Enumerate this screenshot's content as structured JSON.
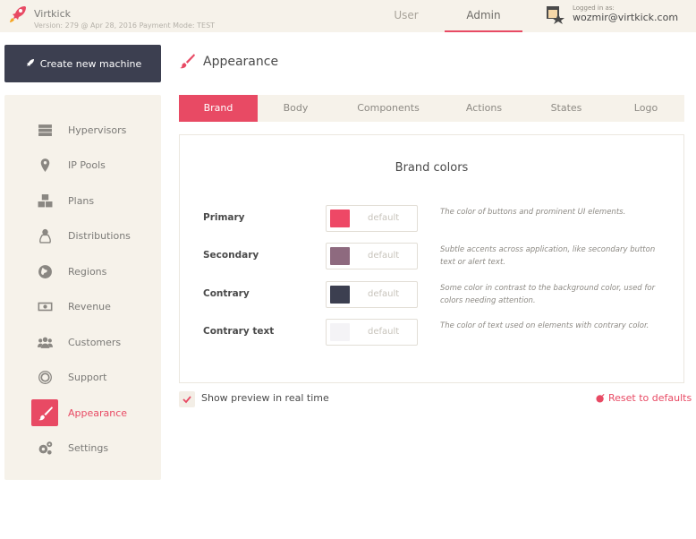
{
  "app": {
    "name": "Virtkick",
    "version_line": "Version: 279 @ Apr 28, 2016 Payment Mode: TEST"
  },
  "top_nav": {
    "tabs": [
      {
        "label": "User",
        "active": false
      },
      {
        "label": "Admin",
        "active": true
      }
    ],
    "logged_in_label": "Logged in as:",
    "logged_in_email": "wozmir@virtkick.com"
  },
  "create_button": {
    "label": "Create new machine",
    "icon": "rocket-icon"
  },
  "sidebar": {
    "items": [
      {
        "label": "Hypervisors",
        "icon": "server-icon",
        "active": false
      },
      {
        "label": "IP Pools",
        "icon": "map-pin-icon",
        "active": false
      },
      {
        "label": "Plans",
        "icon": "cubes-icon",
        "active": false
      },
      {
        "label": "Distributions",
        "icon": "linux-icon",
        "active": false
      },
      {
        "label": "Regions",
        "icon": "globe-icon",
        "active": false
      },
      {
        "label": "Revenue",
        "icon": "money-icon",
        "active": false
      },
      {
        "label": "Customers",
        "icon": "users-icon",
        "active": false
      },
      {
        "label": "Support",
        "icon": "life-ring-icon",
        "active": false
      },
      {
        "label": "Appearance",
        "icon": "paint-brush-icon",
        "active": true
      },
      {
        "label": "Settings",
        "icon": "gears-icon",
        "active": false
      }
    ]
  },
  "page": {
    "title": "Appearance",
    "icon": "paint-brush-icon"
  },
  "tabs": [
    {
      "label": "Brand",
      "active": true
    },
    {
      "label": "Body",
      "active": false
    },
    {
      "label": "Components",
      "active": false
    },
    {
      "label": "Actions",
      "active": false
    },
    {
      "label": "States",
      "active": false
    },
    {
      "label": "Logo",
      "active": false
    }
  ],
  "panel": {
    "title": "Brand colors",
    "rows": [
      {
        "label": "Primary",
        "swatch": "#ee4866",
        "placeholder": "default",
        "description": "The color of buttons and prominent UI elements."
      },
      {
        "label": "Secondary",
        "swatch": "#8e6a7f",
        "placeholder": "default",
        "description": "Subtle accents across application, like secondary button text or alert text."
      },
      {
        "label": "Contrary",
        "swatch": "#3c3f50",
        "placeholder": "default",
        "description": "Some color in contrast to the background color, used for colors needing attention."
      },
      {
        "label": "Contrary text",
        "swatch": "#f4f3f6",
        "placeholder": "default",
        "description": "The color of text used on elements with contrary color."
      }
    ]
  },
  "footer": {
    "preview_label": "Show preview in real time",
    "preview_checked": true,
    "reset_label": "Reset to defaults"
  },
  "colors": {
    "accent": "#e84a64",
    "sidebar_bg": "#f6f2ea",
    "dark": "#3c3f50"
  }
}
